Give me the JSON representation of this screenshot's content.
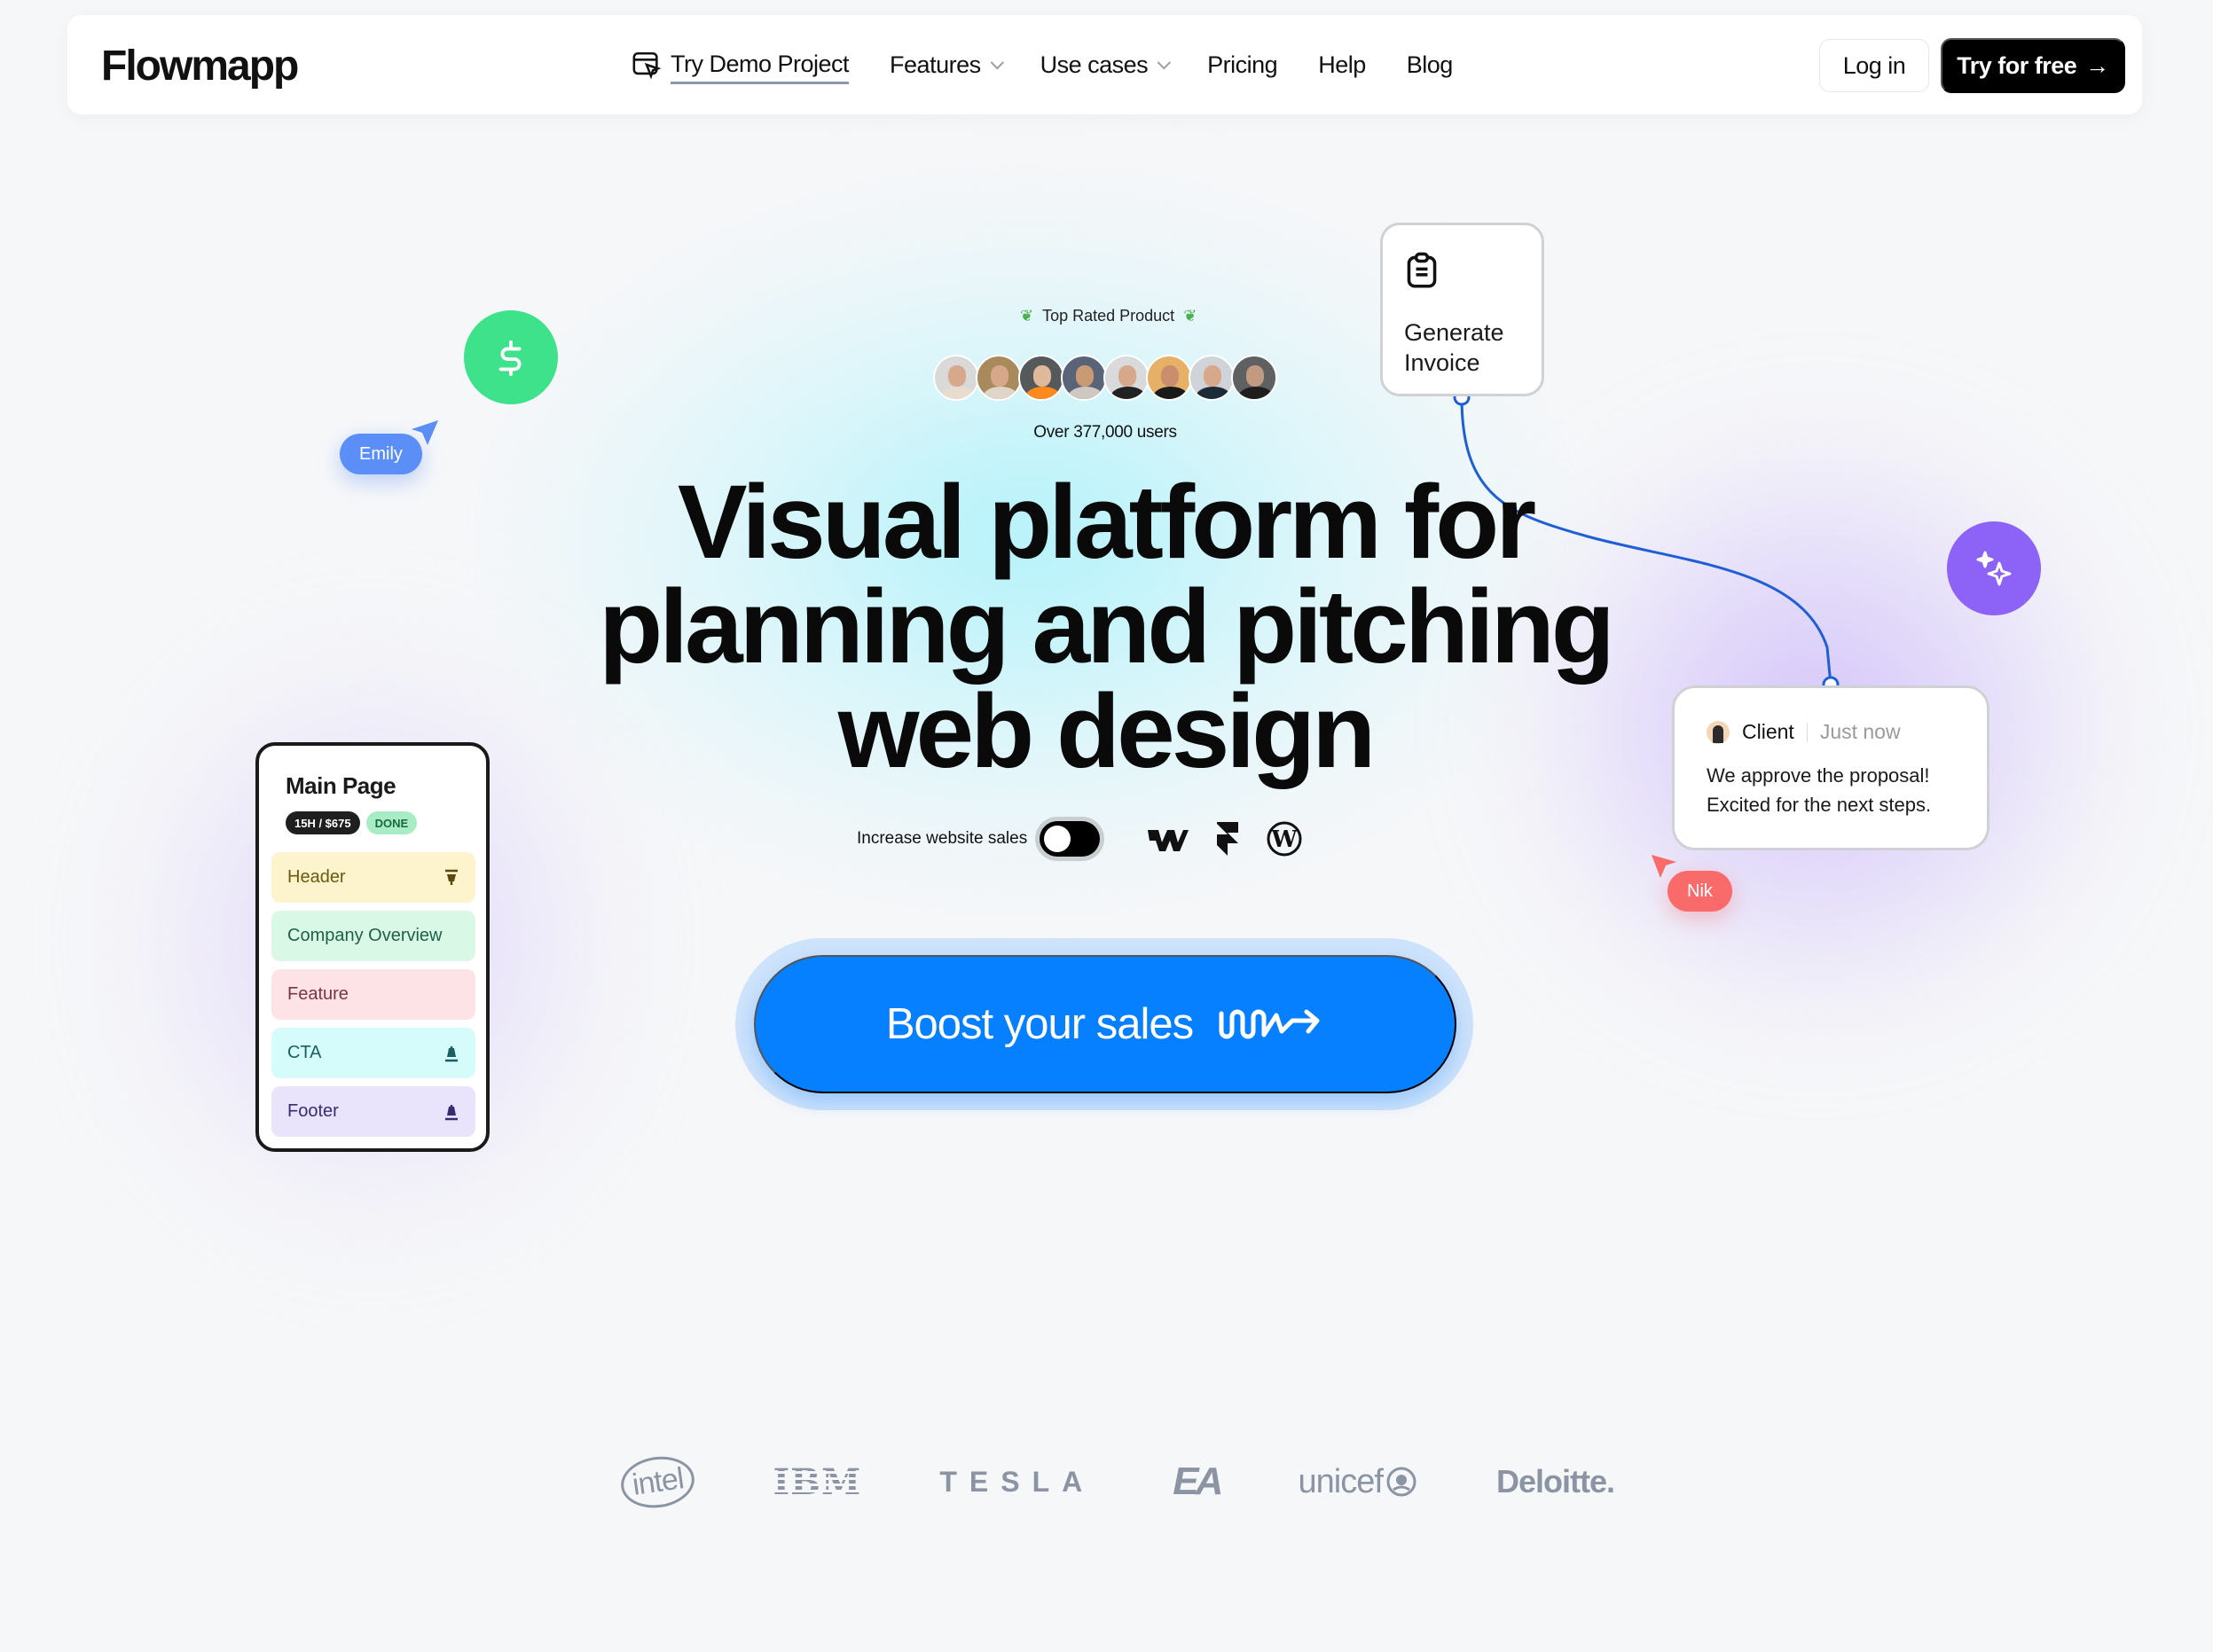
{
  "navbar": {
    "logo": "Flowmapp",
    "demo_link": "Try Demo Project",
    "links": [
      {
        "label": "Features",
        "has_dropdown": true
      },
      {
        "label": "Use cases",
        "has_dropdown": true
      },
      {
        "label": "Pricing",
        "has_dropdown": false
      },
      {
        "label": "Help",
        "has_dropdown": false
      },
      {
        "label": "Blog",
        "has_dropdown": false
      }
    ],
    "login": "Log in",
    "try_free": "Try for free",
    "try_free_arrow": "→"
  },
  "hero": {
    "badge": "Top Rated Product",
    "avatar_count": 8,
    "users_count": "Over 377,000 users",
    "title_lines": [
      "Visual platform for",
      "planning and pitching",
      "web design"
    ],
    "toggle_label": "Increase website sales",
    "toggle_on": false,
    "platforms": [
      "webflow-icon",
      "framer-icon",
      "wordpress-icon"
    ],
    "cta": "Boost your sales"
  },
  "floating": {
    "cursor_emily": "Emily",
    "cursor_nik": "Nik",
    "invoice_card": {
      "line1": "Generate",
      "line2": "Invoice"
    },
    "client_card": {
      "name": "Client",
      "time": "Just now",
      "message_line1": "We approve the proposal!",
      "message_line2": "Excited for the next steps."
    },
    "main_page_card": {
      "title": "Main Page",
      "price_badge": "15H / $675",
      "status_badge": "DONE",
      "sections": [
        {
          "label": "Header",
          "icon": "align-top-icon"
        },
        {
          "label": "Company Overview",
          "icon": ""
        },
        {
          "label": "Feature",
          "icon": ""
        },
        {
          "label": "CTA",
          "icon": "align-bottom-icon"
        },
        {
          "label": "Footer",
          "icon": "align-bottom-icon"
        }
      ]
    }
  },
  "colors": {
    "accent_blue": "#0680ff",
    "green": "#3de28a",
    "purple": "#8c63f6",
    "emily": "#5b8ef7",
    "nik": "#f96b6b"
  },
  "client_logos": [
    "intel",
    "IBM",
    "TESLA",
    "EA",
    "unicef",
    "Deloitte."
  ]
}
